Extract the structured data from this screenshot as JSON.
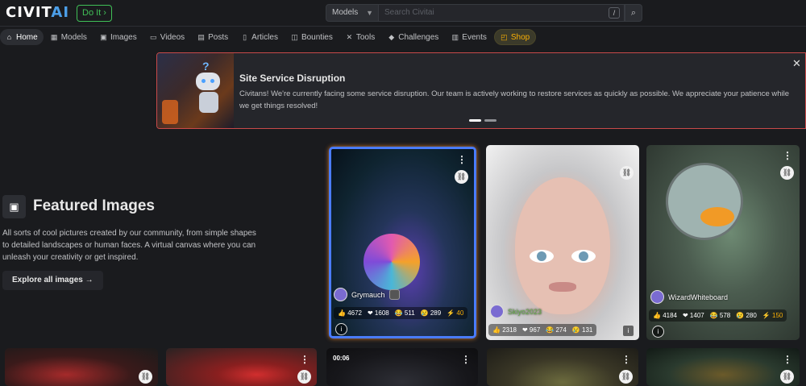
{
  "header": {
    "logo_main": "CIVIT",
    "logo_accent": "AI",
    "doit_label": "Do It ›",
    "search_scope": "Models",
    "search_placeholder": "Search Civitai",
    "search_shortcut": "/"
  },
  "nav": {
    "items": [
      {
        "label": "Home",
        "icon": "home-icon"
      },
      {
        "label": "Models",
        "icon": "models-icon"
      },
      {
        "label": "Images",
        "icon": "images-icon"
      },
      {
        "label": "Videos",
        "icon": "videos-icon"
      },
      {
        "label": "Posts",
        "icon": "posts-icon"
      },
      {
        "label": "Articles",
        "icon": "articles-icon"
      },
      {
        "label": "Bounties",
        "icon": "bounties-icon"
      },
      {
        "label": "Tools",
        "icon": "tools-icon"
      },
      {
        "label": "Challenges",
        "icon": "challenges-icon"
      },
      {
        "label": "Events",
        "icon": "events-icon"
      },
      {
        "label": "Shop",
        "icon": "shop-icon"
      }
    ]
  },
  "banner": {
    "title": "Site Service Disruption",
    "text": "Civitans! We're currently facing some service disruption. Our team is actively working to restore services as quickly as possible. We appreciate your patience while we get things resolved!",
    "close_icon": "close-icon"
  },
  "featured": {
    "title": "Featured Images",
    "description": "All sorts of cool pictures created by our community, from simple shapes to detailed landscapes or human faces. A virtual canvas where you can unleash your creativity or get inspired.",
    "explore_label": "Explore all images →"
  },
  "cards": [
    {
      "user": "Grymauch",
      "likes": "4672",
      "hearts": "1608",
      "laughs": "511",
      "cries": "289",
      "buzz": "40"
    },
    {
      "user": "Skiyo2023",
      "likes": "2318",
      "hearts": "967",
      "laughs": "274",
      "cries": "131",
      "buzz": ""
    },
    {
      "user": "WizardWhiteboard",
      "likes": "4184",
      "hearts": "1407",
      "laughs": "578",
      "cries": "280",
      "buzz": "150"
    }
  ],
  "bottom_cards": {
    "video_timer": "00:06"
  },
  "colors": {
    "background": "#1a1b1e",
    "accent_blue": "#4c9fe8",
    "doit_green": "#40c057",
    "banner_border": "#c94a4a",
    "buzz_yellow": "#fab005"
  }
}
